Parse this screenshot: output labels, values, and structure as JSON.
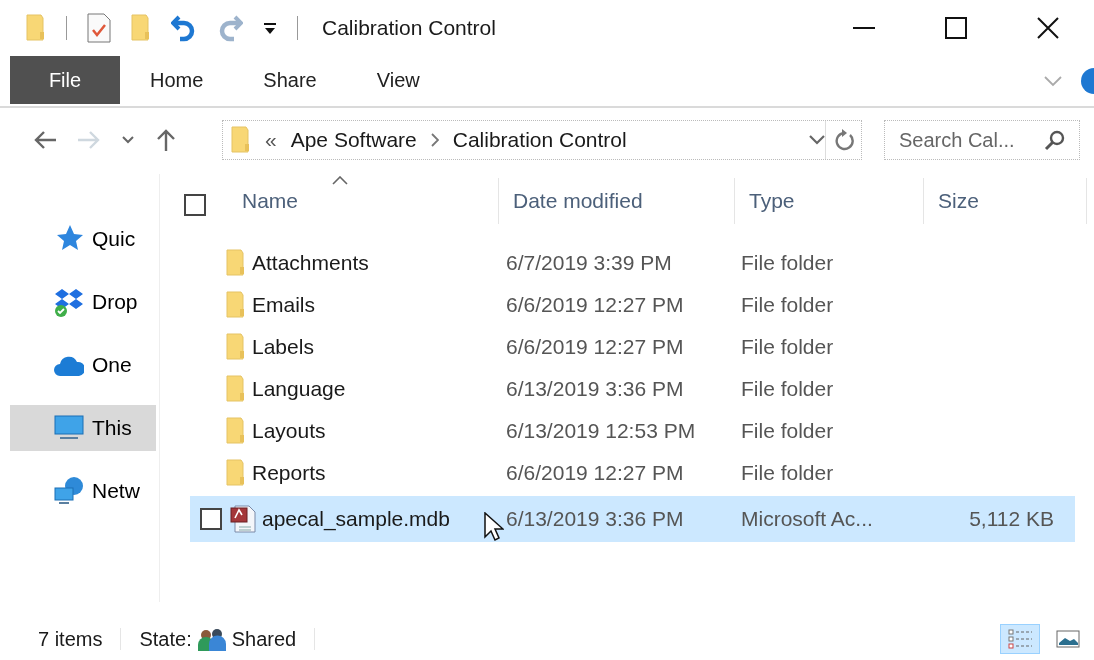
{
  "title_bar": {
    "title": "Calibration Control"
  },
  "ribbon": {
    "tabs": [
      {
        "label": "File",
        "kind": "file",
        "selected": false
      },
      {
        "label": "Home",
        "kind": "tab",
        "selected": false
      },
      {
        "label": "Share",
        "kind": "tab",
        "selected": false
      },
      {
        "label": "View",
        "kind": "tab",
        "selected": false
      }
    ]
  },
  "address_bar": {
    "overflow": "«",
    "crumbs": [
      "Ape Software",
      "Calibration Control"
    ]
  },
  "search": {
    "placeholder": "Search Cal..."
  },
  "nav_pane": {
    "items": [
      {
        "label": "Quic",
        "kind": "quick",
        "selected": false
      },
      {
        "label": "Drop",
        "kind": "dropbox",
        "selected": false
      },
      {
        "label": "One",
        "kind": "cloud",
        "selected": false
      },
      {
        "label": "This",
        "kind": "pc",
        "selected": true
      },
      {
        "label": "Netw",
        "kind": "network",
        "selected": false
      }
    ]
  },
  "file_list": {
    "select_all": {
      "checked": false
    },
    "columns": [
      {
        "label": "Name",
        "sorted": true
      },
      {
        "label": "Date modified",
        "sorted": false
      },
      {
        "label": "Type",
        "sorted": false
      },
      {
        "label": "Size",
        "sorted": false
      }
    ],
    "rows": [
      {
        "name": "Attachments",
        "date": "6/7/2019 3:39 PM",
        "type": "File folder",
        "kind": "folder",
        "selected": false
      },
      {
        "name": "Emails",
        "date": "6/6/2019 12:27 PM",
        "type": "File folder",
        "kind": "folder",
        "selected": false
      },
      {
        "name": "Labels",
        "date": "6/6/2019 12:27 PM",
        "type": "File folder",
        "kind": "folder",
        "selected": false
      },
      {
        "name": "Language",
        "date": "6/13/2019 3:36 PM",
        "type": "File folder",
        "kind": "folder",
        "selected": false
      },
      {
        "name": "Layouts",
        "date": "6/13/2019 12:53 PM",
        "type": "File folder",
        "kind": "folder",
        "selected": false
      },
      {
        "name": "Reports",
        "date": "6/6/2019 12:27 PM",
        "type": "File folder",
        "kind": "folder",
        "selected": false
      },
      {
        "name": "apecal_sample.mdb",
        "date": "6/13/2019 3:36 PM",
        "type": "Microsoft Ac...",
        "size": "5,112 KB",
        "kind": "database",
        "selected": true,
        "checked": false
      }
    ]
  },
  "status_bar": {
    "item_count": "7 items",
    "state_label": "State:",
    "state_value": "Shared",
    "view_buttons": [
      {
        "kind": "details",
        "selected": true
      },
      {
        "kind": "thumbnails",
        "selected": false
      }
    ]
  }
}
